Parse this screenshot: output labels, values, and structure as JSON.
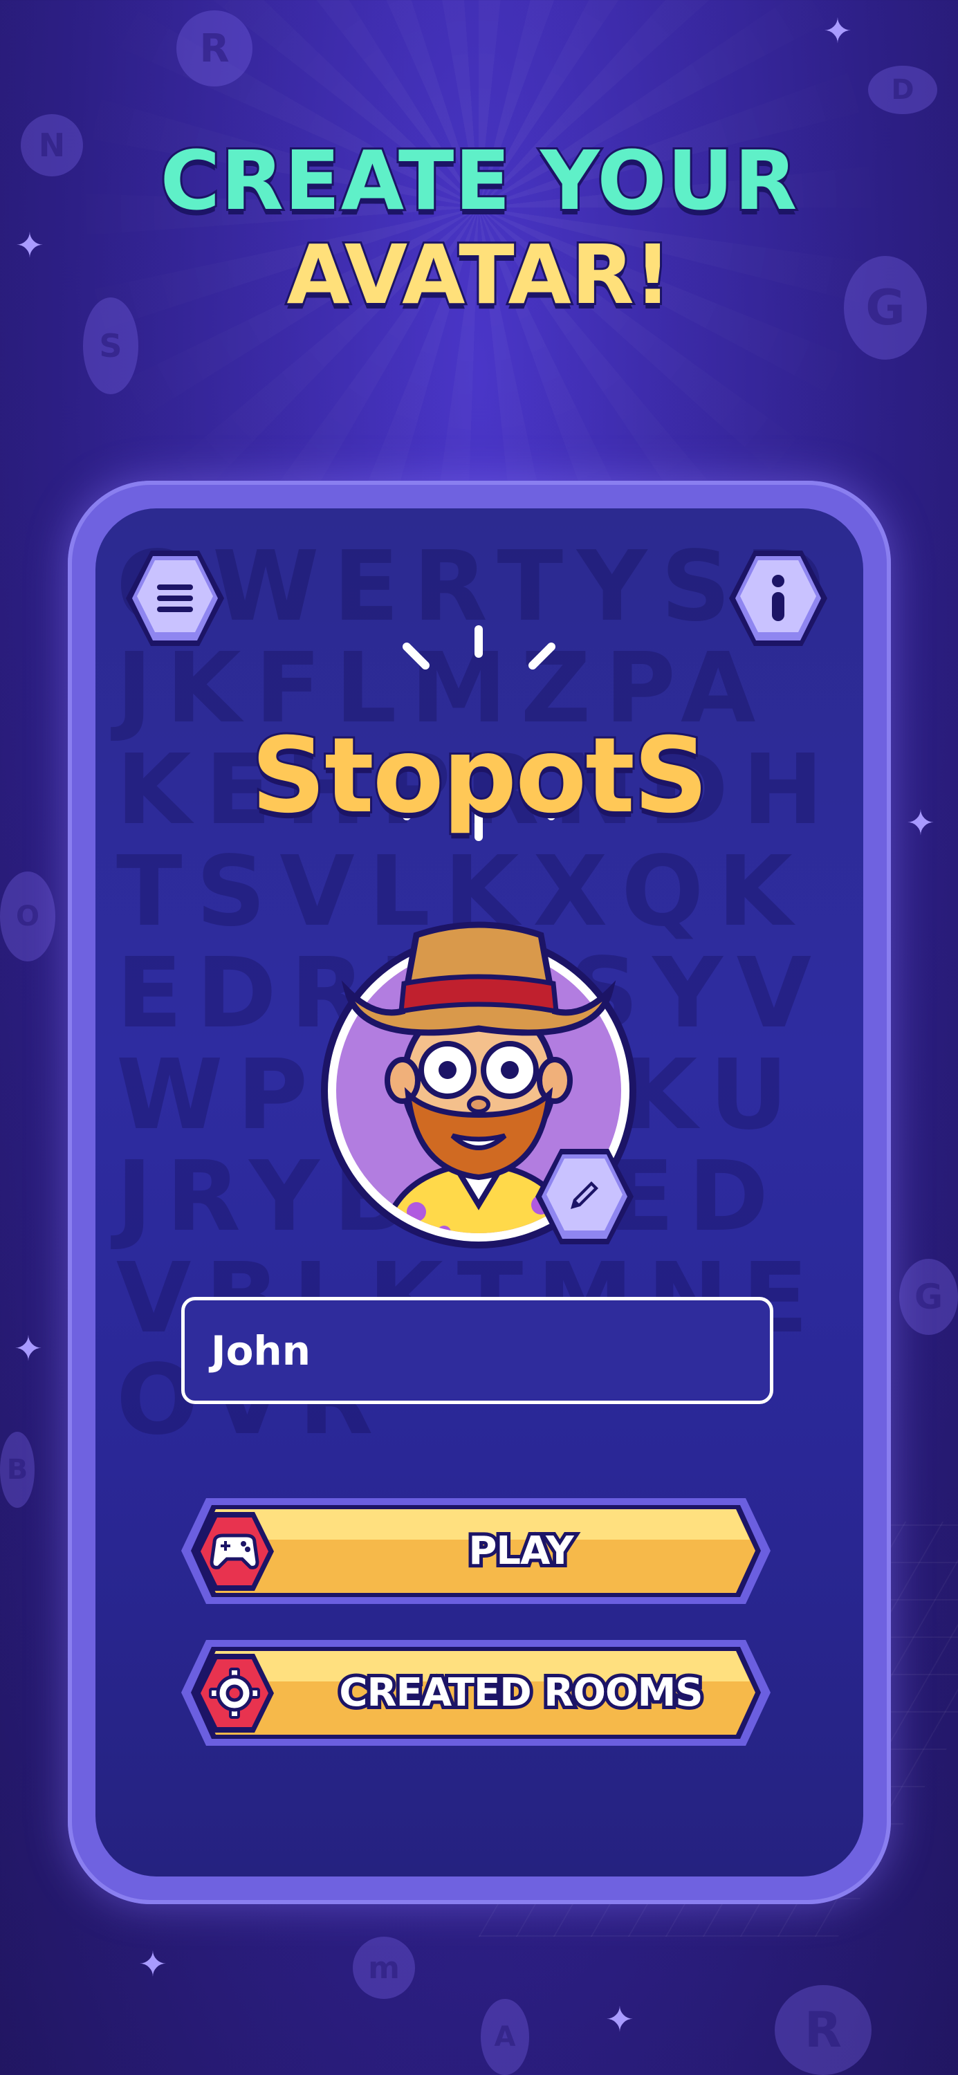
{
  "headline": {
    "line1": "CREATE YOUR",
    "line2": "AVATAR!"
  },
  "app": {
    "logo_text": "StopotS"
  },
  "toolbar": {
    "menu_icon": "hamburger-icon",
    "info_icon": "info-icon"
  },
  "avatar": {
    "description_icon": "cowboy-avatar",
    "edit_icon": "pencil-icon"
  },
  "name_field": {
    "value": "John"
  },
  "buttons": {
    "play_label": "PLAY",
    "play_icon": "gamepad-icon",
    "rooms_label": "CREATED ROOMS",
    "rooms_icon": "gear-icon"
  },
  "colors": {
    "background": "#2d1f86",
    "headline_primary": "#5ff0c8",
    "headline_secondary": "#ffe07a",
    "logo": "#ffc857",
    "button_fill": "#ffd36b",
    "button_icon_bg": "#e8334f",
    "card_border": "#6f62e0"
  }
}
